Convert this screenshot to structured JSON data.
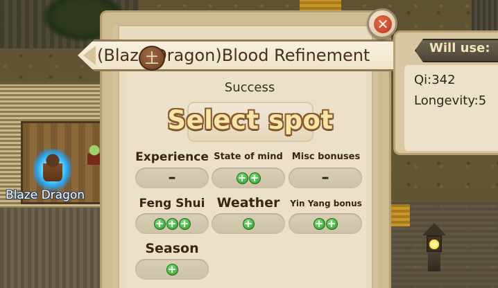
{
  "dialog": {
    "title": "(Blaze Dragon)Blood Refinement",
    "element_badge": "土",
    "close_icon": "close-icon",
    "status": "Success",
    "action_title": "Select spot",
    "bonuses": [
      {
        "id": "experience",
        "label": "Experience",
        "value": "–",
        "plus_count": 0
      },
      {
        "id": "state-of-mind",
        "label": "State of mind",
        "value": "",
        "plus_count": 2
      },
      {
        "id": "misc-bonuses",
        "label": "Misc bonuses",
        "value": "–",
        "plus_count": 0
      },
      {
        "id": "feng-shui",
        "label": "Feng Shui",
        "value": "",
        "plus_count": 3
      },
      {
        "id": "weather",
        "label": "Weather",
        "value": "",
        "plus_count": 1
      },
      {
        "id": "yin-yang-bonus",
        "label": "Yin Yang bonus",
        "value": "",
        "plus_count": 2
      },
      {
        "id": "season",
        "label": "Season",
        "value": "",
        "plus_count": 1
      }
    ],
    "plus_symbol": "+"
  },
  "cost_panel": {
    "header": "Will use:",
    "lines": [
      "Qi:342",
      "Longevity:5"
    ]
  },
  "world": {
    "character_name": "Blaze Dragon"
  }
}
